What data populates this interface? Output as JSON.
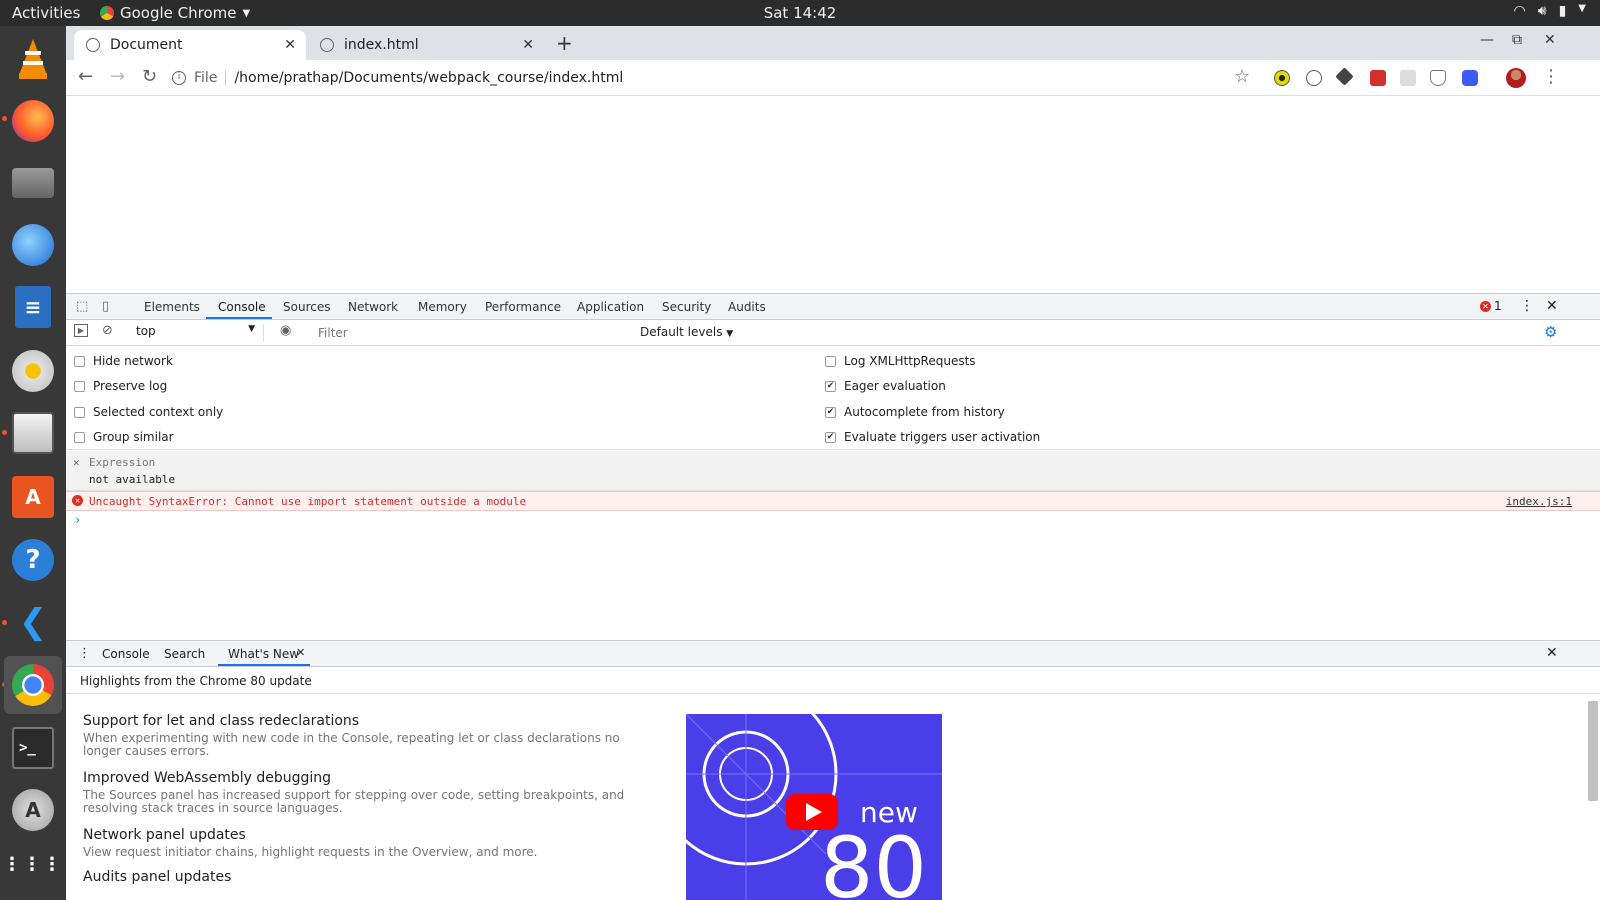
{
  "topbar": {
    "activities": "Activities",
    "app_name": "Google Chrome",
    "clock": "Sat 14:42"
  },
  "dock": {
    "items": [
      "vlc",
      "firefox",
      "scanner",
      "thunderbird",
      "libreoffice-writer",
      "rhythmbox",
      "files",
      "software-center",
      "help",
      "vscode",
      "chrome",
      "terminal",
      "software-updater",
      "show-apps"
    ]
  },
  "browser": {
    "tabs": [
      {
        "title": "Document"
      },
      {
        "title": "index.html"
      }
    ],
    "omnibox": {
      "scheme": "File",
      "url": "/home/prathap/Documents/webpack_course/index.html"
    }
  },
  "devtools": {
    "tabs": [
      "Elements",
      "Console",
      "Sources",
      "Network",
      "Memory",
      "Performance",
      "Application",
      "Security",
      "Audits"
    ],
    "active_tab": "Console",
    "error_count": "1",
    "context": "top",
    "filter_placeholder": "Filter",
    "levels": "Default levels",
    "settings_left": [
      {
        "label": "Hide network",
        "checked": false
      },
      {
        "label": "Preserve log",
        "checked": false
      },
      {
        "label": "Selected context only",
        "checked": false
      },
      {
        "label": "Group similar",
        "checked": false
      }
    ],
    "settings_right": [
      {
        "label": "Log XMLHttpRequests",
        "checked": false
      },
      {
        "label": "Eager evaluation",
        "checked": true
      },
      {
        "label": "Autocomplete from history",
        "checked": true
      },
      {
        "label": "Evaluate triggers user activation",
        "checked": true
      }
    ],
    "expression": {
      "label": "Expression",
      "value": "not available"
    },
    "error": {
      "message": "Uncaught SyntaxError: Cannot use import statement outside a module",
      "source": "index.js:1"
    },
    "drawer": {
      "tabs": [
        "Console",
        "Search",
        "What's New"
      ],
      "highlights": "Highlights from the Chrome 80 update",
      "features": [
        {
          "title": "Support for let and class redeclarations",
          "desc": "When experimenting with new code in the Console, repeating let or class declarations no longer causes errors."
        },
        {
          "title": "Improved WebAssembly debugging",
          "desc": "The Sources panel has increased support for stepping over code, setting breakpoints, and resolving stack traces in source languages."
        },
        {
          "title": "Network panel updates",
          "desc": "View request initiator chains, highlight requests in the Overview, and more."
        },
        {
          "title": "Audits panel updates",
          "desc": ""
        }
      ],
      "video": {
        "word": "new",
        "number": "80"
      }
    }
  }
}
